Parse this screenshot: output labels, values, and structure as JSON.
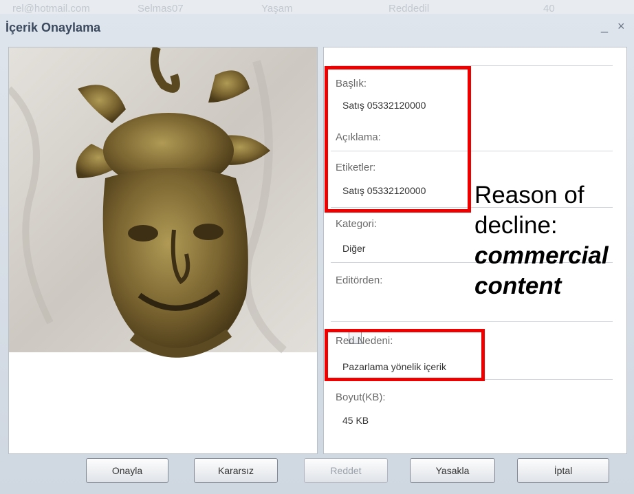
{
  "background_texts": [
    "rel@hotmail.com",
    "Selmas07",
    "Yaşam",
    "Reddedil",
    "40"
  ],
  "window": {
    "title": "İçerik Onaylama",
    "minimize_symbol": "_",
    "close_symbol": "×"
  },
  "details": {
    "title_label": "Başlık:",
    "title_value": "Satış 05332120000",
    "description_label": "Açıklama:",
    "description_value": "",
    "tags_label": "Etiketler:",
    "tags_value": "Satış 05332120000",
    "category_label": "Kategori:",
    "category_value": "Diğer",
    "editor_label": "Editörden:",
    "editor_checked": false,
    "reject_label": "Red Nedeni:",
    "reject_value": "Pazarlama yönelik içerik",
    "size_label": "Boyut(KB):",
    "size_value": "45 KB"
  },
  "annotation": {
    "line1": "Reason of",
    "line2": "decline:",
    "line3": "commercial",
    "line4": "content",
    "highlight_color": "#ee0000"
  },
  "buttons": {
    "approve": "Onayla",
    "undecided": "Kararsız",
    "reject": "Reddet",
    "ban": "Yasakla",
    "cancel": "İptal"
  },
  "icons": {
    "minimize": "minimize-icon",
    "close": "close-icon",
    "checkbox": "checkbox-icon"
  }
}
